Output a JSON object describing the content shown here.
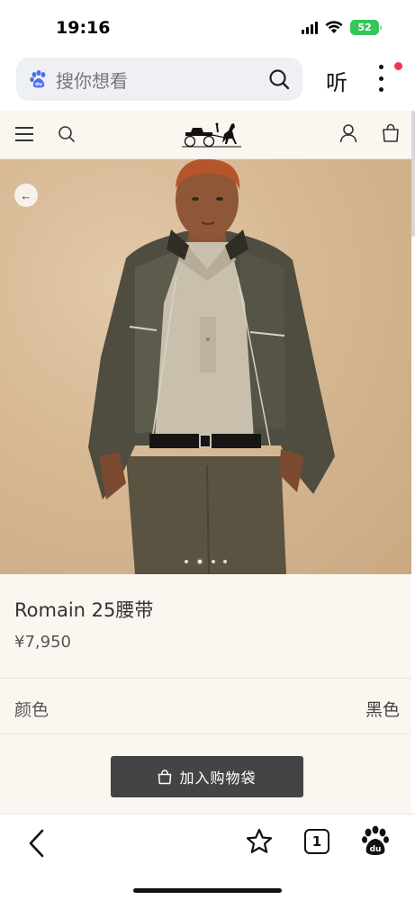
{
  "status_bar": {
    "time": "19:16",
    "battery": "52"
  },
  "browser": {
    "search_placeholder": "搜你想看",
    "listen_label": "听"
  },
  "site_header": {
    "icons": [
      "menu-icon",
      "search-icon",
      "hermes-logo",
      "account-icon",
      "shopping-bag-icon"
    ]
  },
  "product": {
    "title": "Romain 25腰带",
    "price": "¥7,950",
    "color_label": "颜色",
    "color_value": "黑色",
    "add_to_bag_label": "加入购物袋",
    "carousel": {
      "total": 4,
      "active_index": 1
    }
  },
  "bottom_bar": {
    "tab_count": "1"
  },
  "colors": {
    "page_bg": "#fbf6f0",
    "button_bg": "#444444",
    "battery_green": "#34c759",
    "notification_red": "#f2344f"
  }
}
